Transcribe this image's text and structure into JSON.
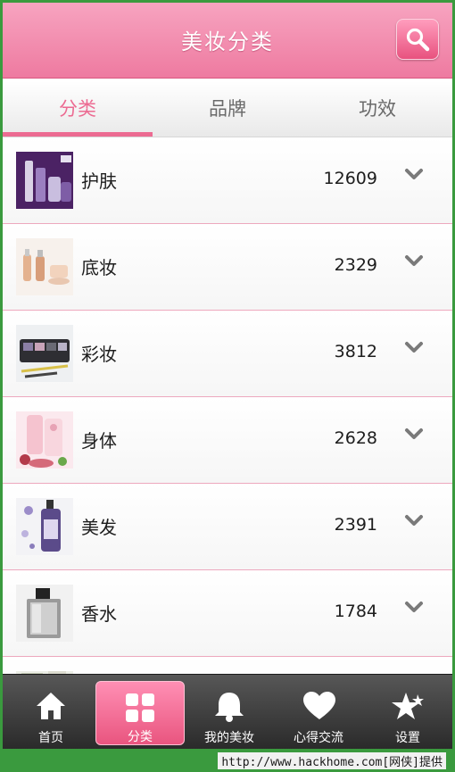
{
  "header": {
    "title": "美妆分类",
    "search_icon": "search-icon"
  },
  "tabs": [
    {
      "label": "分类",
      "active": true
    },
    {
      "label": "品牌",
      "active": false
    },
    {
      "label": "功效",
      "active": false
    }
  ],
  "categories": [
    {
      "name": "护肤",
      "count": "12609",
      "thumb": "skincare-bottles"
    },
    {
      "name": "底妆",
      "count": "2329",
      "thumb": "foundation-bottles"
    },
    {
      "name": "彩妆",
      "count": "3812",
      "thumb": "eyeshadow-palette"
    },
    {
      "name": "身体",
      "count": "2628",
      "thumb": "body-lotion-tubes"
    },
    {
      "name": "美发",
      "count": "2391",
      "thumb": "hair-care-bottle"
    },
    {
      "name": "香水",
      "count": "1784",
      "thumb": "perfume-bottle"
    }
  ],
  "bottom_nav": [
    {
      "label": "首页",
      "icon": "home-icon",
      "active": false
    },
    {
      "label": "分类",
      "icon": "grid-icon",
      "active": true
    },
    {
      "label": "我的美妆",
      "icon": "bell-icon",
      "active": false
    },
    {
      "label": "心得交流",
      "icon": "heart-icon",
      "active": false
    },
    {
      "label": "设置",
      "icon": "star-icon",
      "active": false
    }
  ],
  "watermark": "http://www.hackhome.com[网侠]提供",
  "colors": {
    "accent": "#ec6b92",
    "header": "#f39bb8",
    "divider": "#eda8be",
    "frame": "#3a9a3e"
  }
}
